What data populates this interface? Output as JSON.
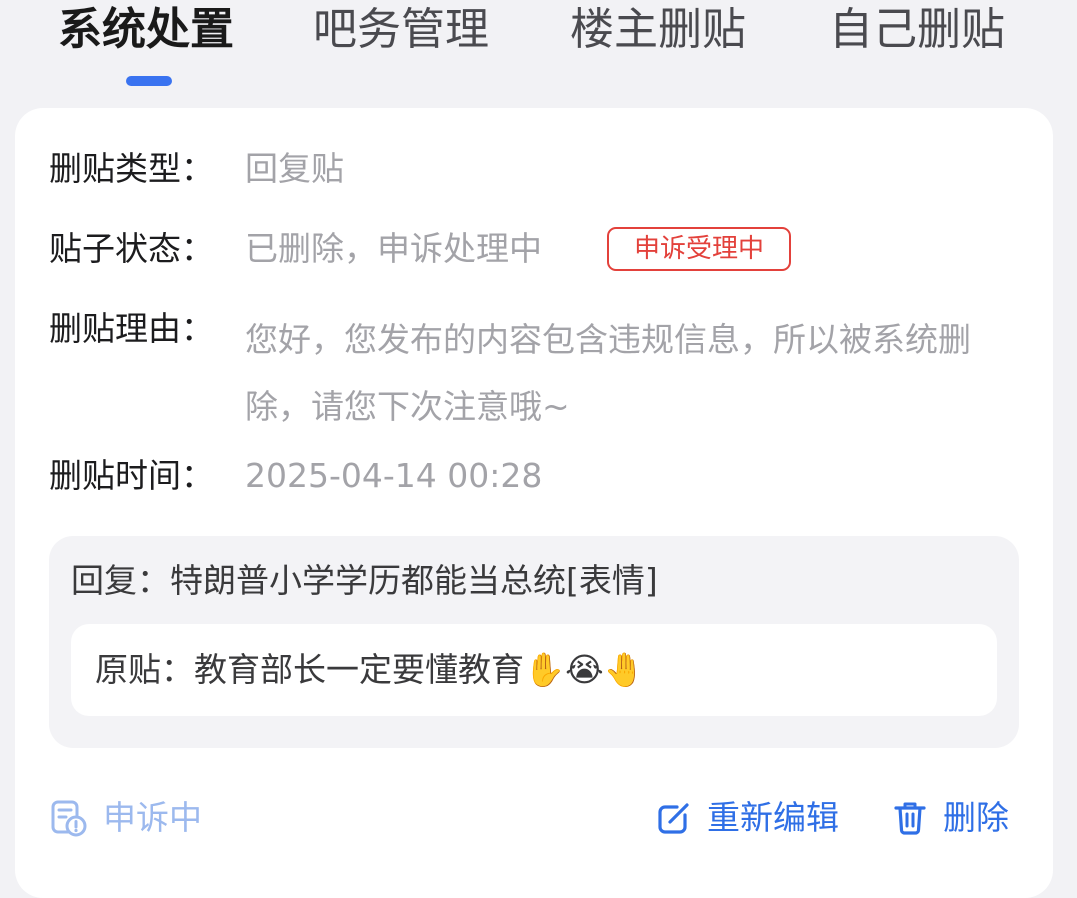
{
  "tabs": [
    {
      "label": "系统处置",
      "active": true
    },
    {
      "label": "吧务管理",
      "active": false
    },
    {
      "label": "楼主删贴",
      "active": false
    },
    {
      "label": "自己删贴",
      "active": false
    }
  ],
  "details": {
    "type_label": "删贴类型：",
    "type_value": "回复贴",
    "status_label": "贴子状态：",
    "status_value": "已删除，申诉处理中",
    "status_badge": "申诉受理中",
    "reason_label": "删贴理由：",
    "reason_value": "您好，您发布的内容包含违规信息，所以被系统删除，请您下次注意哦~",
    "time_label": "删贴时间：",
    "time_value": "2025-04-14 00:28"
  },
  "reply": {
    "text": "回复：特朗普小学学历都能当总统[表情]",
    "original_text": "原贴：教育部长一定要懂教育✋😭🤚"
  },
  "footer": {
    "appeal_icon": "document-clock-icon",
    "appeal_label": "申诉中",
    "edit_icon": "edit-icon",
    "edit_label": "重新编辑",
    "delete_icon": "trash-icon",
    "delete_label": "删除"
  },
  "colors": {
    "accent": "#2f6fe6",
    "badge_red": "#e3413b",
    "muted_text": "#a3a3a8",
    "appeal_light_blue": "#9cb9ee"
  }
}
